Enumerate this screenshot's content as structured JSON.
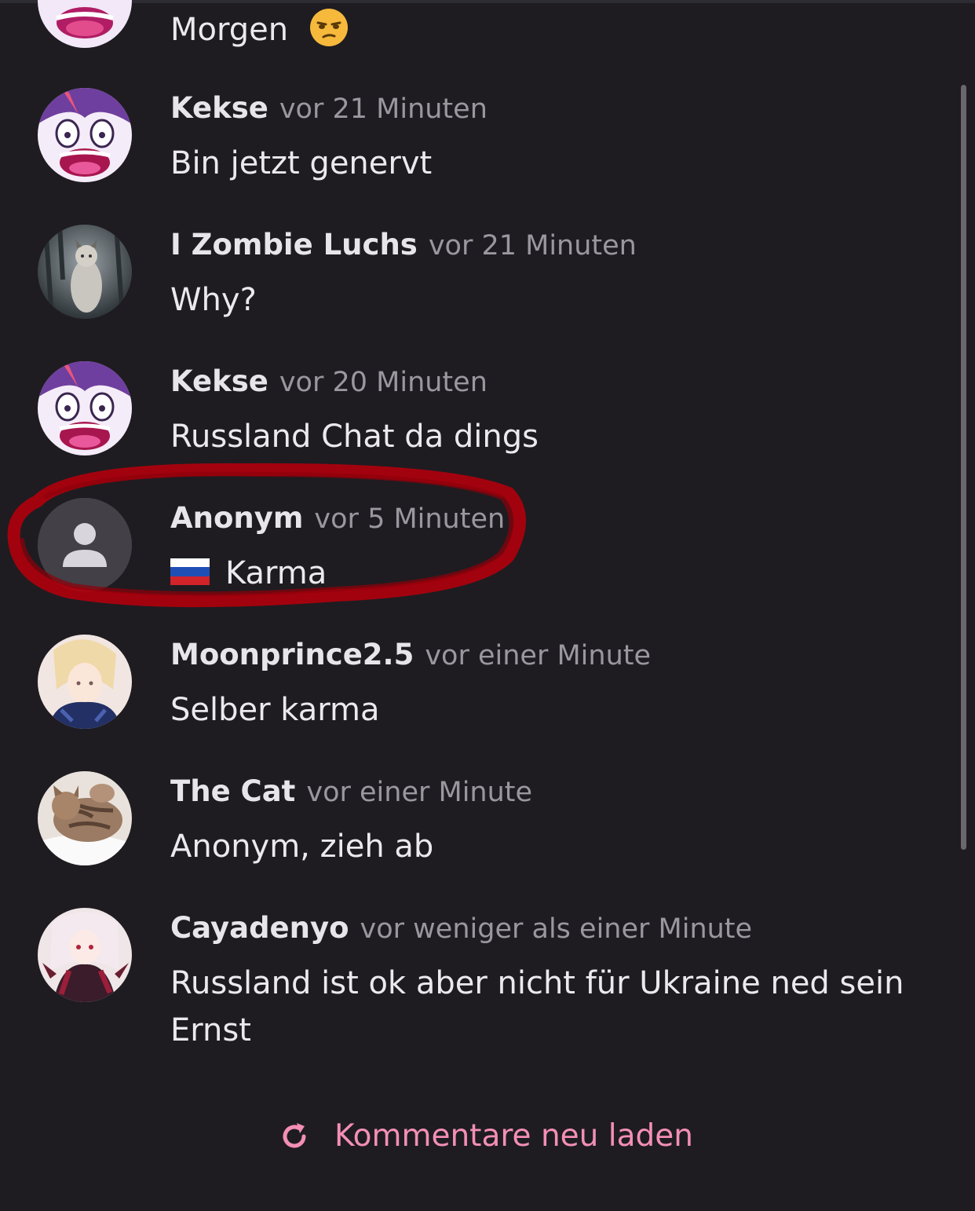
{
  "comments": [
    {
      "author": "",
      "time": "",
      "text": "Morgen",
      "avatar": "pony-icon"
    },
    {
      "author": "Kekse",
      "time": "vor 21 Minuten",
      "text": "Bin jetzt genervt",
      "avatar": "pony-icon"
    },
    {
      "author": "I Zombie Luchs",
      "time": "vor 21 Minuten",
      "text": "Why?",
      "avatar": "lynx-icon"
    },
    {
      "author": "Kekse",
      "time": "vor 20 Minuten",
      "text": "Russland Chat da dings",
      "avatar": "pony-icon"
    },
    {
      "author": "Anonym",
      "time": "vor 5 Minuten",
      "text": "Karma",
      "avatar": "user-icon"
    },
    {
      "author": "Moonprince2.5",
      "time": "vor einer Minute",
      "text": "Selber karma",
      "avatar": "anime-icon"
    },
    {
      "author": "The Cat",
      "time": "vor einer Minute",
      "text": "Anonym, zieh ab",
      "avatar": "cat-icon"
    },
    {
      "author": "Cayadenyo",
      "time": "vor weniger als einer Minute",
      "text": "Russland ist ok aber nicht für Ukraine ned sein",
      "text2": "Ernst",
      "avatar": "anime-icon"
    }
  ],
  "reload_label": "Kommentare neu laden",
  "colors": {
    "background": "#1e1c21",
    "accent": "#f48fb4",
    "annotation": "#b0000c"
  }
}
